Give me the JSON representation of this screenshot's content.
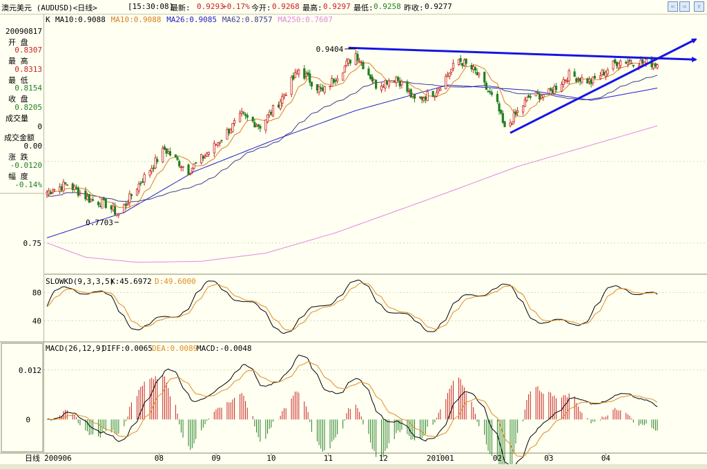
{
  "header": {
    "instrument": "澳元美元 (AUDUSD)<日线>",
    "time": "[15:30:08]",
    "latest_label": "最新:",
    "latest_value": "0.9293",
    "change_value": "+0.17%",
    "open_label": "今开:",
    "open_value": "0.9268",
    "high_label": "最高:",
    "high_value": "0.9297",
    "low_label": "最低:",
    "low_value": "0.9258",
    "prev_label": "昨收:",
    "prev_value": "0.9277"
  },
  "nav_icons": [
    "nav-prev-icon",
    "nav-next-icon",
    "nav-first-icon",
    "nav-last-icon"
  ],
  "info_panel": {
    "date": "20090817",
    "open_label": "开 盘",
    "open": "0.8307",
    "high_label": "最 高",
    "high": "0.8313",
    "low_label": "最 低",
    "low": "0.8154",
    "close_label": "收 盘",
    "close": "0.8205",
    "volume_label": "成交量",
    "volume": "0",
    "amount_label": "成交金额",
    "amount": "0.00",
    "change_label": "涨 跌",
    "change": "-0.0120",
    "pct_label": "幅 度",
    "pct": "-0.14%"
  },
  "colors": {
    "background": "#fffff2",
    "up_candle": "#c8201e",
    "down_candle": "#208020",
    "ma10": "#d8801e",
    "ma26": "#1e1ec8",
    "ma62": "#3c3c8c",
    "ma250": "#e088e0",
    "trendline": "#1414e6",
    "k_line": "#000000",
    "d_line": "#e08c1e"
  },
  "chart_data": [
    {
      "type": "candlestick",
      "title": "K",
      "legend": [
        {
          "name": "MA10",
          "value": "0.9088",
          "label": "MA10:0.9088"
        },
        {
          "name": "MA10",
          "value": "0.9088",
          "label": "MA10:0.9088"
        },
        {
          "name": "MA26",
          "value": "0.9085",
          "label": "MA26:0.9085"
        },
        {
          "name": "MA62",
          "value": "0.8757",
          "label": "MA62:0.8757"
        },
        {
          "name": "MA250",
          "value": "0.7607",
          "label": "MA250:0.7607"
        }
      ],
      "y_ticks": [
        0.75
      ],
      "ylim": [
        0.72,
        0.96
      ],
      "annotations": [
        {
          "text": "0.9404",
          "value": 0.9404,
          "date": "2009-11-16"
        },
        {
          "text": "0.7703",
          "value": 0.7703,
          "date": "2009-07-10"
        }
      ],
      "x_labels": [
        "2009-06",
        "2009-08",
        "2009-09",
        "2009-10",
        "2009-11",
        "2009-12",
        "2010-01",
        "2010-02",
        "2010-03",
        "2010-04"
      ],
      "x_tick_text": [
        "200906",
        "08",
        "09",
        "10",
        "11",
        "12",
        "201001",
        "02",
        "03",
        "04"
      ],
      "x_axis_label": "日线",
      "date_range": [
        "2009-06-01",
        "2010-04-29"
      ],
      "price_keypoints": [
        [
          "2009-06-01",
          0.8
        ],
        [
          "2009-06-12",
          0.808
        ],
        [
          "2009-06-24",
          0.793
        ],
        [
          "2009-07-03",
          0.788
        ],
        [
          "2009-07-10",
          0.778
        ],
        [
          "2009-07-20",
          0.805
        ],
        [
          "2009-08-04",
          0.842
        ],
        [
          "2009-08-17",
          0.8205
        ],
        [
          "2009-08-31",
          0.845
        ],
        [
          "2009-09-15",
          0.875
        ],
        [
          "2009-09-25",
          0.865
        ],
        [
          "2009-10-06",
          0.89
        ],
        [
          "2009-10-16",
          0.92
        ],
        [
          "2009-10-29",
          0.898
        ],
        [
          "2009-11-16",
          0.936
        ],
        [
          "2009-11-27",
          0.905
        ],
        [
          "2009-12-08",
          0.913
        ],
        [
          "2009-12-18",
          0.89
        ],
        [
          "2009-12-29",
          0.898
        ],
        [
          "2010-01-11",
          0.93
        ],
        [
          "2010-01-20",
          0.918
        ],
        [
          "2010-02-01",
          0.885
        ],
        [
          "2010-02-05",
          0.861
        ],
        [
          "2010-02-18",
          0.893
        ],
        [
          "2010-03-01",
          0.897
        ],
        [
          "2010-03-12",
          0.915
        ],
        [
          "2010-03-24",
          0.908
        ],
        [
          "2010-04-08",
          0.929
        ],
        [
          "2010-04-29",
          0.926
        ]
      ],
      "ma26_keypoints": [
        [
          "2009-06-01",
          0.755
        ],
        [
          "2009-07-13",
          0.78
        ],
        [
          "2009-08-20",
          0.82
        ],
        [
          "2009-10-01",
          0.85
        ],
        [
          "2009-11-16",
          0.88
        ],
        [
          "2010-01-05",
          0.905
        ],
        [
          "2010-02-18",
          0.9
        ],
        [
          "2010-03-24",
          0.89
        ],
        [
          "2010-04-29",
          0.902
        ]
      ],
      "ma250_keypoints": [
        [
          "2009-06-01",
          0.75
        ],
        [
          "2009-06-22",
          0.736
        ],
        [
          "2009-07-20",
          0.731
        ],
        [
          "2009-08-24",
          0.732
        ],
        [
          "2009-09-28",
          0.74
        ],
        [
          "2009-11-05",
          0.76
        ],
        [
          "2009-12-29",
          0.795
        ],
        [
          "2010-02-12",
          0.825
        ],
        [
          "2010-04-29",
          0.865
        ]
      ],
      "trendlines": [
        {
          "name": "resistance",
          "from": [
            "2009-11-12",
            0.9415
          ],
          "to": [
            "2010-05-05",
            0.93
          ]
        },
        {
          "name": "support",
          "from": [
            "2010-02-08",
            0.858
          ],
          "to": [
            "2010-05-05",
            0.95
          ]
        }
      ]
    },
    {
      "type": "line",
      "title": "SLOWKD(9,3,3,5)",
      "series": [
        {
          "name": "K",
          "last": "45.6972",
          "label": "K:45.6972"
        },
        {
          "name": "D",
          "last": "49.6000",
          "label": "D:49.6000"
        }
      ],
      "y_ticks": [
        80,
        40
      ],
      "ylim": [
        10,
        100
      ]
    },
    {
      "type": "bar",
      "title": "MACD(26,12,9)",
      "series": [
        {
          "name": "DIFF",
          "last": "0.0065",
          "label": "DIFF:0.0065"
        },
        {
          "name": "DEA",
          "last": "0.0089",
          "label": "DEA:0.0089"
        },
        {
          "name": "MACD",
          "last": "-0.0048",
          "label": "MACD:-0.0048"
        }
      ],
      "y_ticks": [
        "0.012",
        "0"
      ],
      "ylim": [
        -0.008,
        0.018
      ]
    }
  ]
}
